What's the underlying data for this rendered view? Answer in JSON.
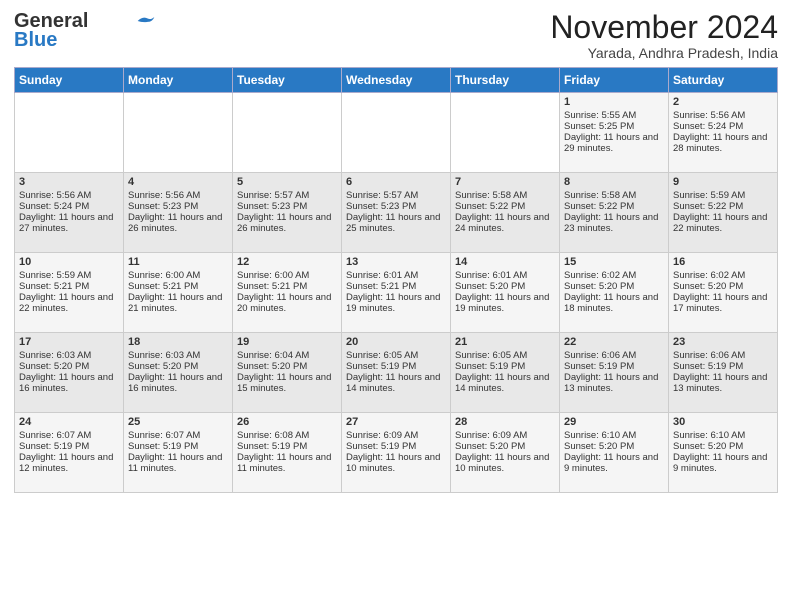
{
  "header": {
    "logo_line1": "General",
    "logo_line2": "Blue",
    "month": "November 2024",
    "location": "Yarada, Andhra Pradesh, India"
  },
  "weekdays": [
    "Sunday",
    "Monday",
    "Tuesday",
    "Wednesday",
    "Thursday",
    "Friday",
    "Saturday"
  ],
  "weeks": [
    [
      {
        "day": "",
        "sunrise": "",
        "sunset": "",
        "daylight": ""
      },
      {
        "day": "",
        "sunrise": "",
        "sunset": "",
        "daylight": ""
      },
      {
        "day": "",
        "sunrise": "",
        "sunset": "",
        "daylight": ""
      },
      {
        "day": "",
        "sunrise": "",
        "sunset": "",
        "daylight": ""
      },
      {
        "day": "",
        "sunrise": "",
        "sunset": "",
        "daylight": ""
      },
      {
        "day": "1",
        "sunrise": "Sunrise: 5:55 AM",
        "sunset": "Sunset: 5:25 PM",
        "daylight": "Daylight: 11 hours and 29 minutes."
      },
      {
        "day": "2",
        "sunrise": "Sunrise: 5:56 AM",
        "sunset": "Sunset: 5:24 PM",
        "daylight": "Daylight: 11 hours and 28 minutes."
      }
    ],
    [
      {
        "day": "3",
        "sunrise": "Sunrise: 5:56 AM",
        "sunset": "Sunset: 5:24 PM",
        "daylight": "Daylight: 11 hours and 27 minutes."
      },
      {
        "day": "4",
        "sunrise": "Sunrise: 5:56 AM",
        "sunset": "Sunset: 5:23 PM",
        "daylight": "Daylight: 11 hours and 26 minutes."
      },
      {
        "day": "5",
        "sunrise": "Sunrise: 5:57 AM",
        "sunset": "Sunset: 5:23 PM",
        "daylight": "Daylight: 11 hours and 26 minutes."
      },
      {
        "day": "6",
        "sunrise": "Sunrise: 5:57 AM",
        "sunset": "Sunset: 5:23 PM",
        "daylight": "Daylight: 11 hours and 25 minutes."
      },
      {
        "day": "7",
        "sunrise": "Sunrise: 5:58 AM",
        "sunset": "Sunset: 5:22 PM",
        "daylight": "Daylight: 11 hours and 24 minutes."
      },
      {
        "day": "8",
        "sunrise": "Sunrise: 5:58 AM",
        "sunset": "Sunset: 5:22 PM",
        "daylight": "Daylight: 11 hours and 23 minutes."
      },
      {
        "day": "9",
        "sunrise": "Sunrise: 5:59 AM",
        "sunset": "Sunset: 5:22 PM",
        "daylight": "Daylight: 11 hours and 22 minutes."
      }
    ],
    [
      {
        "day": "10",
        "sunrise": "Sunrise: 5:59 AM",
        "sunset": "Sunset: 5:21 PM",
        "daylight": "Daylight: 11 hours and 22 minutes."
      },
      {
        "day": "11",
        "sunrise": "Sunrise: 6:00 AM",
        "sunset": "Sunset: 5:21 PM",
        "daylight": "Daylight: 11 hours and 21 minutes."
      },
      {
        "day": "12",
        "sunrise": "Sunrise: 6:00 AM",
        "sunset": "Sunset: 5:21 PM",
        "daylight": "Daylight: 11 hours and 20 minutes."
      },
      {
        "day": "13",
        "sunrise": "Sunrise: 6:01 AM",
        "sunset": "Sunset: 5:21 PM",
        "daylight": "Daylight: 11 hours and 19 minutes."
      },
      {
        "day": "14",
        "sunrise": "Sunrise: 6:01 AM",
        "sunset": "Sunset: 5:20 PM",
        "daylight": "Daylight: 11 hours and 19 minutes."
      },
      {
        "day": "15",
        "sunrise": "Sunrise: 6:02 AM",
        "sunset": "Sunset: 5:20 PM",
        "daylight": "Daylight: 11 hours and 18 minutes."
      },
      {
        "day": "16",
        "sunrise": "Sunrise: 6:02 AM",
        "sunset": "Sunset: 5:20 PM",
        "daylight": "Daylight: 11 hours and 17 minutes."
      }
    ],
    [
      {
        "day": "17",
        "sunrise": "Sunrise: 6:03 AM",
        "sunset": "Sunset: 5:20 PM",
        "daylight": "Daylight: 11 hours and 16 minutes."
      },
      {
        "day": "18",
        "sunrise": "Sunrise: 6:03 AM",
        "sunset": "Sunset: 5:20 PM",
        "daylight": "Daylight: 11 hours and 16 minutes."
      },
      {
        "day": "19",
        "sunrise": "Sunrise: 6:04 AM",
        "sunset": "Sunset: 5:20 PM",
        "daylight": "Daylight: 11 hours and 15 minutes."
      },
      {
        "day": "20",
        "sunrise": "Sunrise: 6:05 AM",
        "sunset": "Sunset: 5:19 PM",
        "daylight": "Daylight: 11 hours and 14 minutes."
      },
      {
        "day": "21",
        "sunrise": "Sunrise: 6:05 AM",
        "sunset": "Sunset: 5:19 PM",
        "daylight": "Daylight: 11 hours and 14 minutes."
      },
      {
        "day": "22",
        "sunrise": "Sunrise: 6:06 AM",
        "sunset": "Sunset: 5:19 PM",
        "daylight": "Daylight: 11 hours and 13 minutes."
      },
      {
        "day": "23",
        "sunrise": "Sunrise: 6:06 AM",
        "sunset": "Sunset: 5:19 PM",
        "daylight": "Daylight: 11 hours and 13 minutes."
      }
    ],
    [
      {
        "day": "24",
        "sunrise": "Sunrise: 6:07 AM",
        "sunset": "Sunset: 5:19 PM",
        "daylight": "Daylight: 11 hours and 12 minutes."
      },
      {
        "day": "25",
        "sunrise": "Sunrise: 6:07 AM",
        "sunset": "Sunset: 5:19 PM",
        "daylight": "Daylight: 11 hours and 11 minutes."
      },
      {
        "day": "26",
        "sunrise": "Sunrise: 6:08 AM",
        "sunset": "Sunset: 5:19 PM",
        "daylight": "Daylight: 11 hours and 11 minutes."
      },
      {
        "day": "27",
        "sunrise": "Sunrise: 6:09 AM",
        "sunset": "Sunset: 5:19 PM",
        "daylight": "Daylight: 11 hours and 10 minutes."
      },
      {
        "day": "28",
        "sunrise": "Sunrise: 6:09 AM",
        "sunset": "Sunset: 5:20 PM",
        "daylight": "Daylight: 11 hours and 10 minutes."
      },
      {
        "day": "29",
        "sunrise": "Sunrise: 6:10 AM",
        "sunset": "Sunset: 5:20 PM",
        "daylight": "Daylight: 11 hours and 9 minutes."
      },
      {
        "day": "30",
        "sunrise": "Sunrise: 6:10 AM",
        "sunset": "Sunset: 5:20 PM",
        "daylight": "Daylight: 11 hours and 9 minutes."
      }
    ]
  ]
}
